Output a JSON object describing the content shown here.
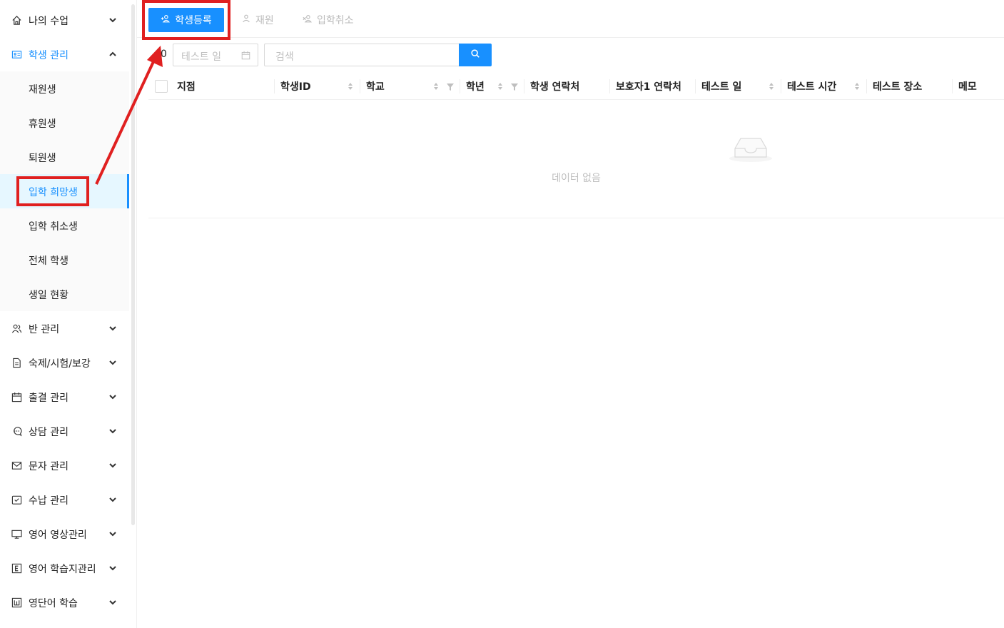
{
  "sidebar": {
    "items": [
      {
        "label": "나의 수업",
        "icon": "home-icon"
      },
      {
        "label": "학생 관리",
        "icon": "id-card-icon"
      },
      {
        "label": "반 관리",
        "icon": "team-icon"
      },
      {
        "label": "숙제/시험/보강",
        "icon": "file-icon"
      },
      {
        "label": "출결 관리",
        "icon": "calendar-icon"
      },
      {
        "label": "상담 관리",
        "icon": "chat-icon"
      },
      {
        "label": "문자 관리",
        "icon": "mail-icon"
      },
      {
        "label": "수납 관리",
        "icon": "inbox-check-icon"
      },
      {
        "label": "영어 영상관리",
        "icon": "monitor-icon"
      },
      {
        "label": "영어 학습지관리",
        "icon": "letter-e-icon"
      },
      {
        "label": "영단어 학습",
        "icon": "letter-w-icon"
      }
    ],
    "submenu": [
      {
        "label": "재원생"
      },
      {
        "label": "휴원생"
      },
      {
        "label": "퇴원생"
      },
      {
        "label": "입학 희망생"
      },
      {
        "label": "입학 취소생"
      },
      {
        "label": "전체 학생"
      },
      {
        "label": "생일 현황"
      }
    ],
    "selected": "입학 희망생"
  },
  "tabs": {
    "register": "학생등록",
    "enroll": "재원",
    "cancel": "입학취소"
  },
  "filters": {
    "lead_value": "0",
    "date_placeholder": "테스트 일",
    "search_placeholder": "검색"
  },
  "table": {
    "columns": [
      "지점",
      "학생ID",
      "학교",
      "학년",
      "학생 연락처",
      "보호자1 연락처",
      "테스트 일",
      "테스트 시간",
      "테스트 장소",
      "메모"
    ],
    "empty_text": "데이터 없음"
  },
  "colors": {
    "primary": "#1890ff",
    "annotation": "#e02020"
  }
}
